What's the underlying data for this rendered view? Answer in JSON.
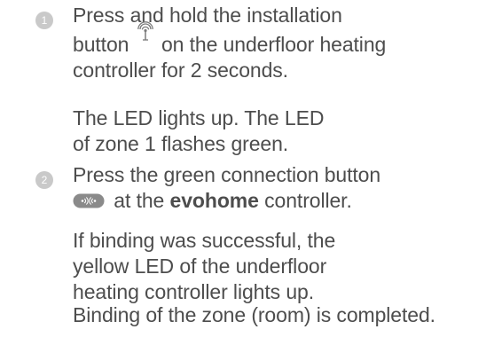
{
  "steps": [
    {
      "number": "1",
      "instruction_before_icon": "Press and hold the installation",
      "instruction_line2_prefix": "button",
      "instruction_line2_suffix": "on the underfloor heating",
      "instruction_line3": "controller for 2 seconds.",
      "result_line1": "The LED lights up. The LED",
      "result_line2": "of zone 1 flashes green.",
      "icon": "installation-signal-icon"
    },
    {
      "number": "2",
      "instruction_line1": "Press the green connection button",
      "instruction_line2_suffix": "at the",
      "brand": "evohome",
      "instruction_line2_end": "controller.",
      "result_a_line1": "If binding was successful, the",
      "result_a_line2": "yellow LED of the underfloor",
      "result_a_line3": "heating controller lights up.",
      "result_b_line1": "Binding of the zone (room) is completed.",
      "icon": "connection-button-icon"
    }
  ],
  "colors": {
    "text": "#4d4d4d",
    "step_badge": "#c9c9c9",
    "icon_fill": "#7a7a7a"
  }
}
